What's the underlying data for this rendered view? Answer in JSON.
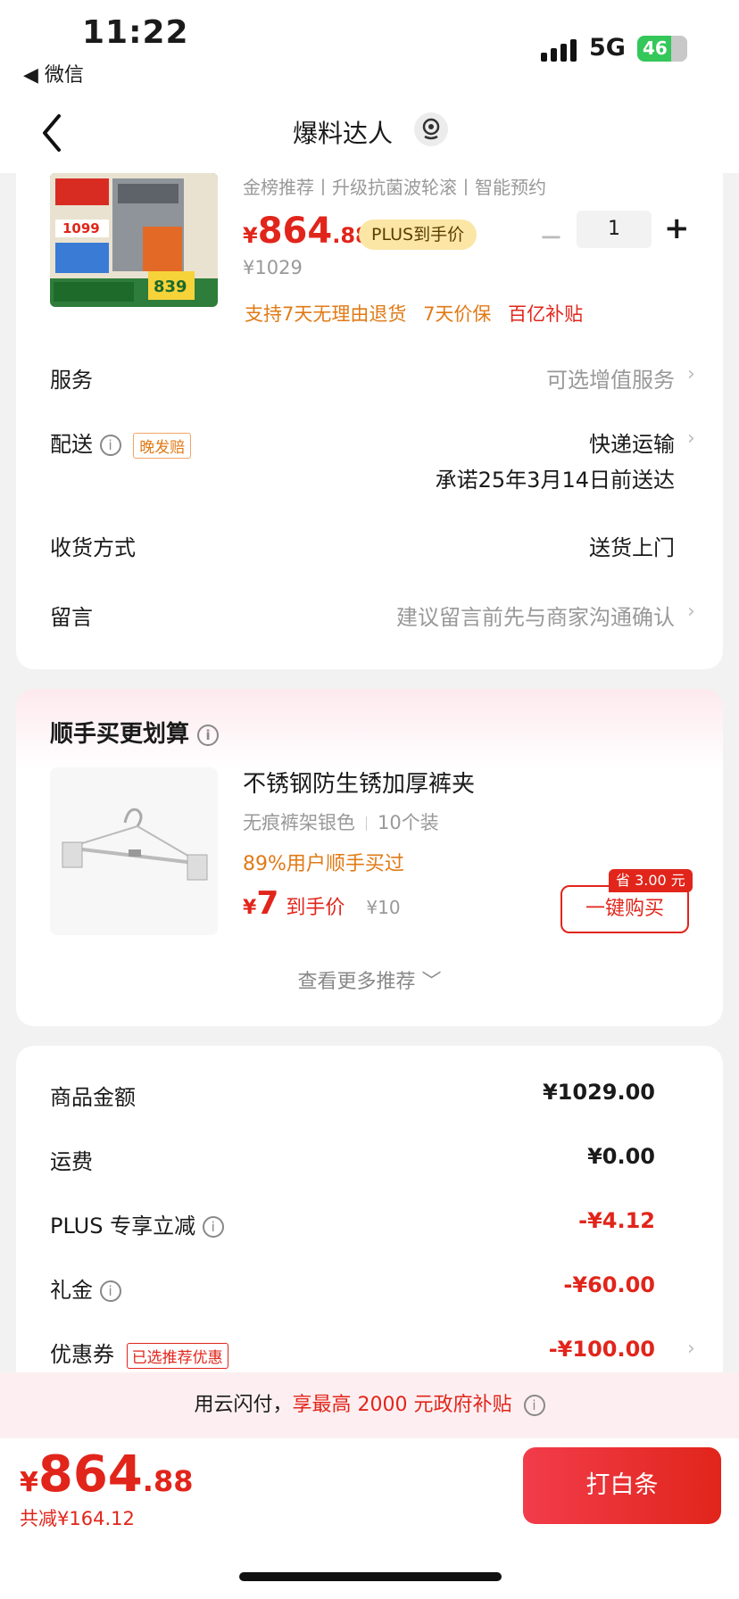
{
  "status": {
    "time": "11:22",
    "back_app": "◀ 微信",
    "network": "5G",
    "battery": "46"
  },
  "nav": {
    "title": "爆料达人"
  },
  "product": {
    "subtitle": "金榜推荐丨升级抗菌波轮滚丨智能预约",
    "price_yen": "¥",
    "price_int": "864",
    "price_dec": ".88",
    "plus_tag": "PLUS到手价",
    "original_price": "¥1029",
    "quantity": "1",
    "perks": [
      "支持7天无理由退货",
      "7天价保",
      "百亿补贴"
    ]
  },
  "rows": {
    "service": {
      "label": "服务",
      "value": "可选增值服务"
    },
    "delivery": {
      "label": "配送",
      "tag": "晚发赔",
      "value": "快递运输",
      "promise": "承诺25年3月14日前送达"
    },
    "receive": {
      "label": "收货方式",
      "value": "送货上门"
    },
    "message": {
      "label": "留言",
      "value": "建议留言前先与商家沟通确认"
    }
  },
  "combo": {
    "title": "顺手买更划算",
    "name": "不锈钢防生锈加厚裤夹",
    "spec1": "无痕裤架银色",
    "spec2": "10个装",
    "stat": "89%用户顺手买过",
    "price_yen": "¥",
    "price_int": "7",
    "price_label": "到手价",
    "price_orig": "¥10",
    "save_badge": "省 3.00 元",
    "buy_label": "一键购买",
    "more": "查看更多推荐 ﹀"
  },
  "summary": {
    "goods": {
      "label": "商品金额",
      "value": "¥1029.00"
    },
    "freight": {
      "label": "运费",
      "value": "¥0.00"
    },
    "plus": {
      "label": "PLUS 专享立减",
      "value": "-¥4.12"
    },
    "gift": {
      "label": "礼金",
      "value": "-¥60.00"
    },
    "coupon": {
      "label": "优惠券",
      "tag": "已选推荐优惠",
      "value": "-¥100.00"
    }
  },
  "banner": {
    "prefix": "用云闪付，",
    "highlight": "享最高 2000 元政府补贴"
  },
  "bottom": {
    "total_yen": "¥",
    "total_int": "864",
    "total_dec": ".88",
    "saved": "共减¥164.12",
    "pay_label": "打白条"
  },
  "colors": {
    "accent": "#e1251b",
    "orange": "#e07a16",
    "plus_gold": "#fbe6a6"
  }
}
